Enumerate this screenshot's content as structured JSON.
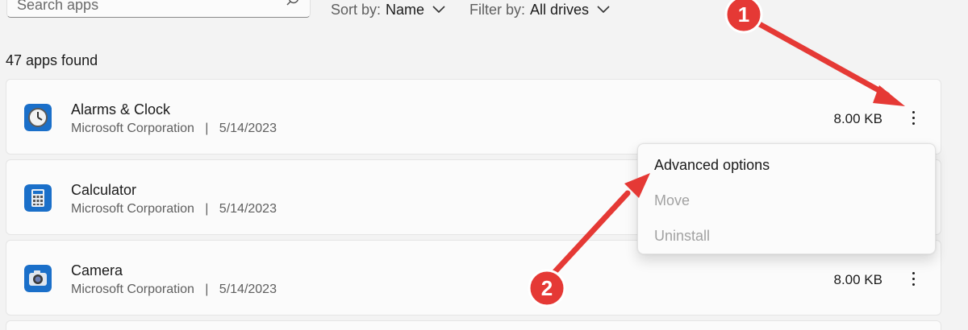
{
  "search": {
    "placeholder": "Search apps",
    "icon": "search-icon"
  },
  "sort": {
    "label": "Sort by:",
    "value": "Name"
  },
  "filter": {
    "label": "Filter by:",
    "value": "All drives"
  },
  "apps_found": "47 apps found",
  "apps": [
    {
      "name": "Alarms & Clock",
      "publisher": "Microsoft Corporation",
      "separator": "|",
      "date": "5/14/2023",
      "size": "8.00 KB",
      "icon": "alarm-clock-icon"
    },
    {
      "name": "Calculator",
      "publisher": "Microsoft Corporation",
      "separator": "|",
      "date": "5/14/2023",
      "size": "",
      "icon": "calculator-icon"
    },
    {
      "name": "Camera",
      "publisher": "Microsoft Corporation",
      "separator": "|",
      "date": "5/14/2023",
      "size": "8.00 KB",
      "icon": "camera-icon"
    }
  ],
  "context_menu": {
    "items": [
      {
        "label": "Advanced options",
        "enabled": true
      },
      {
        "label": "Move",
        "enabled": false
      },
      {
        "label": "Uninstall",
        "enabled": false
      }
    ]
  },
  "annotations": {
    "badges": [
      "1",
      "2"
    ],
    "color": "#e03a3a"
  },
  "colors": {
    "accent": "#0067c0",
    "annotation": "#e53935"
  }
}
